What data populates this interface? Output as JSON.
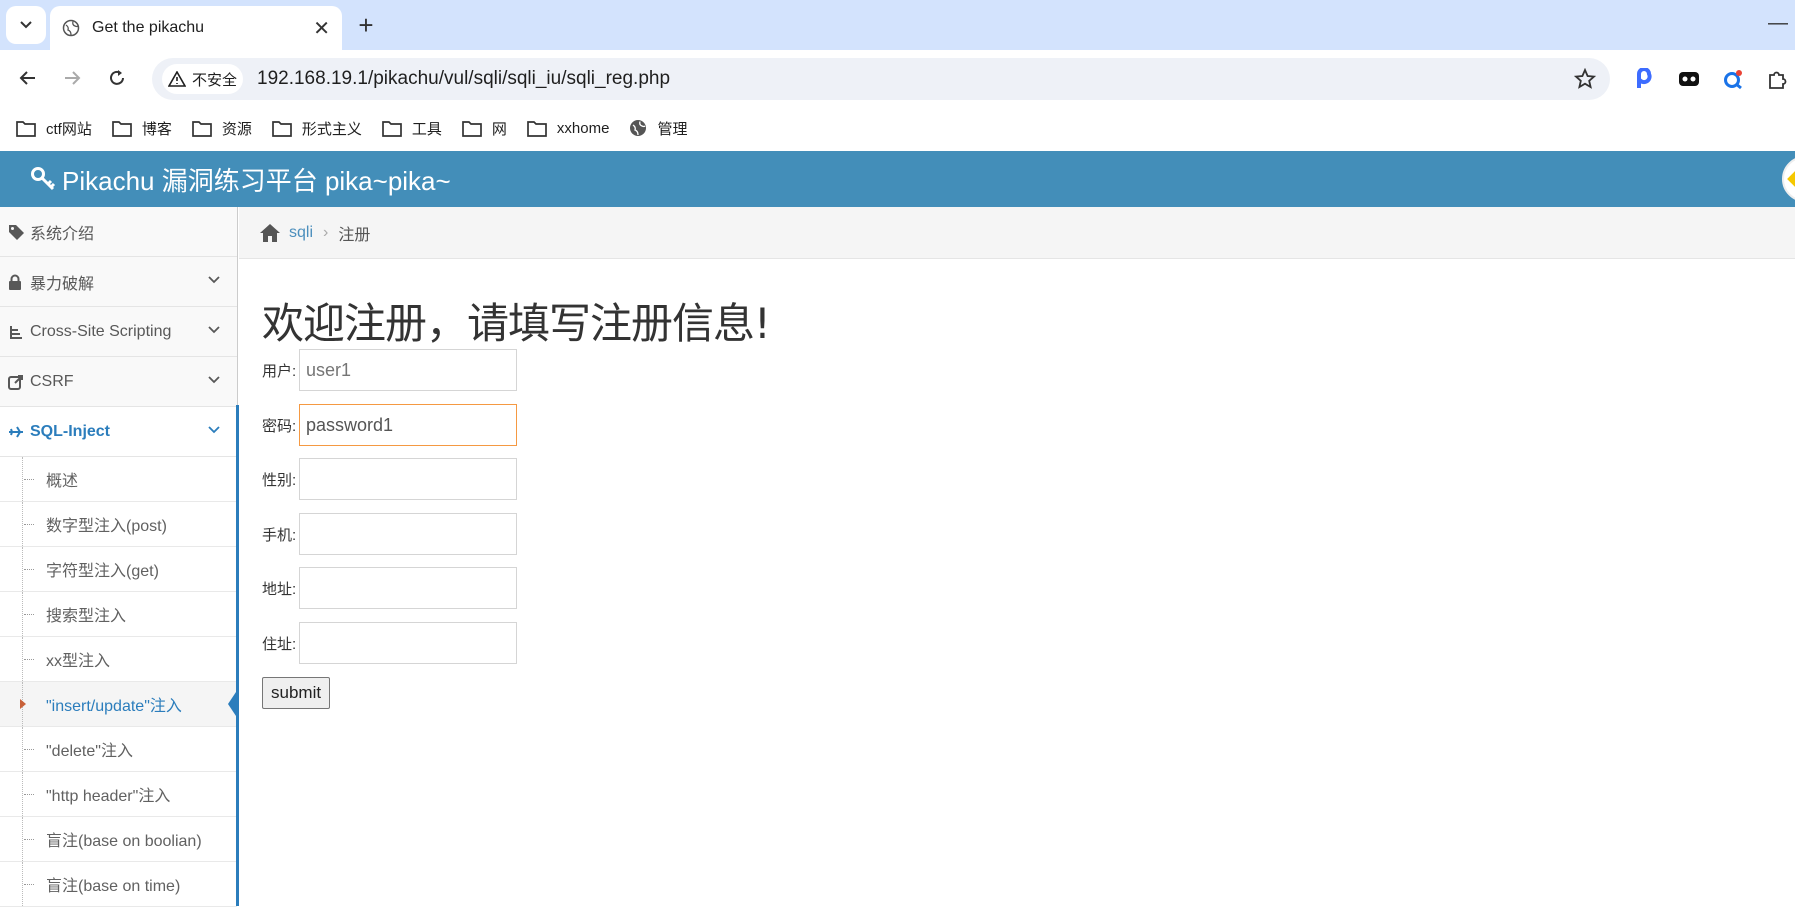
{
  "browser": {
    "tab_title": "Get the pikachu",
    "new_tab_label": "+",
    "security_label": "不安全",
    "url": "192.168.19.1/pikachu/vul/sqli/sqli_iu/sqli_reg.php"
  },
  "bookmarks": [
    {
      "label": "ctf网站",
      "icon": "folder-icon"
    },
    {
      "label": "博客",
      "icon": "folder-icon"
    },
    {
      "label": "资源",
      "icon": "folder-icon"
    },
    {
      "label": "形式主义",
      "icon": "folder-icon"
    },
    {
      "label": "工具",
      "icon": "folder-icon"
    },
    {
      "label": "网",
      "icon": "folder-icon"
    },
    {
      "label": "xxhome",
      "icon": "folder-icon"
    },
    {
      "label": "管理",
      "icon": "globe-icon"
    }
  ],
  "header": {
    "brand": "Pikachu 漏洞练习平台 pika~pika~"
  },
  "sidebar": {
    "items": [
      {
        "label": "系统介绍",
        "icon": "tags-icon"
      },
      {
        "label": "暴力破解",
        "icon": "lock-icon"
      },
      {
        "label": "Cross-Site Scripting",
        "icon": "sitemap-icon"
      },
      {
        "label": "CSRF",
        "icon": "share-icon"
      },
      {
        "label": "SQL-Inject",
        "icon": "plane-icon"
      }
    ],
    "subitems": [
      "概述",
      "数字型注入(post)",
      "字符型注入(get)",
      "搜索型注入",
      "xx型注入",
      "\"insert/update\"注入",
      "\"delete\"注入",
      "\"http header\"注入",
      "盲注(base on boolian)",
      "盲注(base on time)"
    ]
  },
  "breadcrumb": {
    "link": "sqli",
    "current": "注册"
  },
  "form": {
    "heading": "欢迎注册，请填写注册信息!",
    "fields": [
      {
        "label": "用户:",
        "value": "",
        "placeholder": "user1"
      },
      {
        "label": "密码:",
        "value": "password1",
        "placeholder": ""
      },
      {
        "label": "性别:",
        "value": "",
        "placeholder": ""
      },
      {
        "label": "手机:",
        "value": "",
        "placeholder": ""
      },
      {
        "label": "地址:",
        "value": "",
        "placeholder": ""
      },
      {
        "label": "住址:",
        "value": "",
        "placeholder": ""
      }
    ],
    "submit_label": "submit"
  },
  "colors": {
    "header_bg": "#438eb9",
    "accent": "#2b7dbc",
    "focus_border": "#f59942"
  }
}
